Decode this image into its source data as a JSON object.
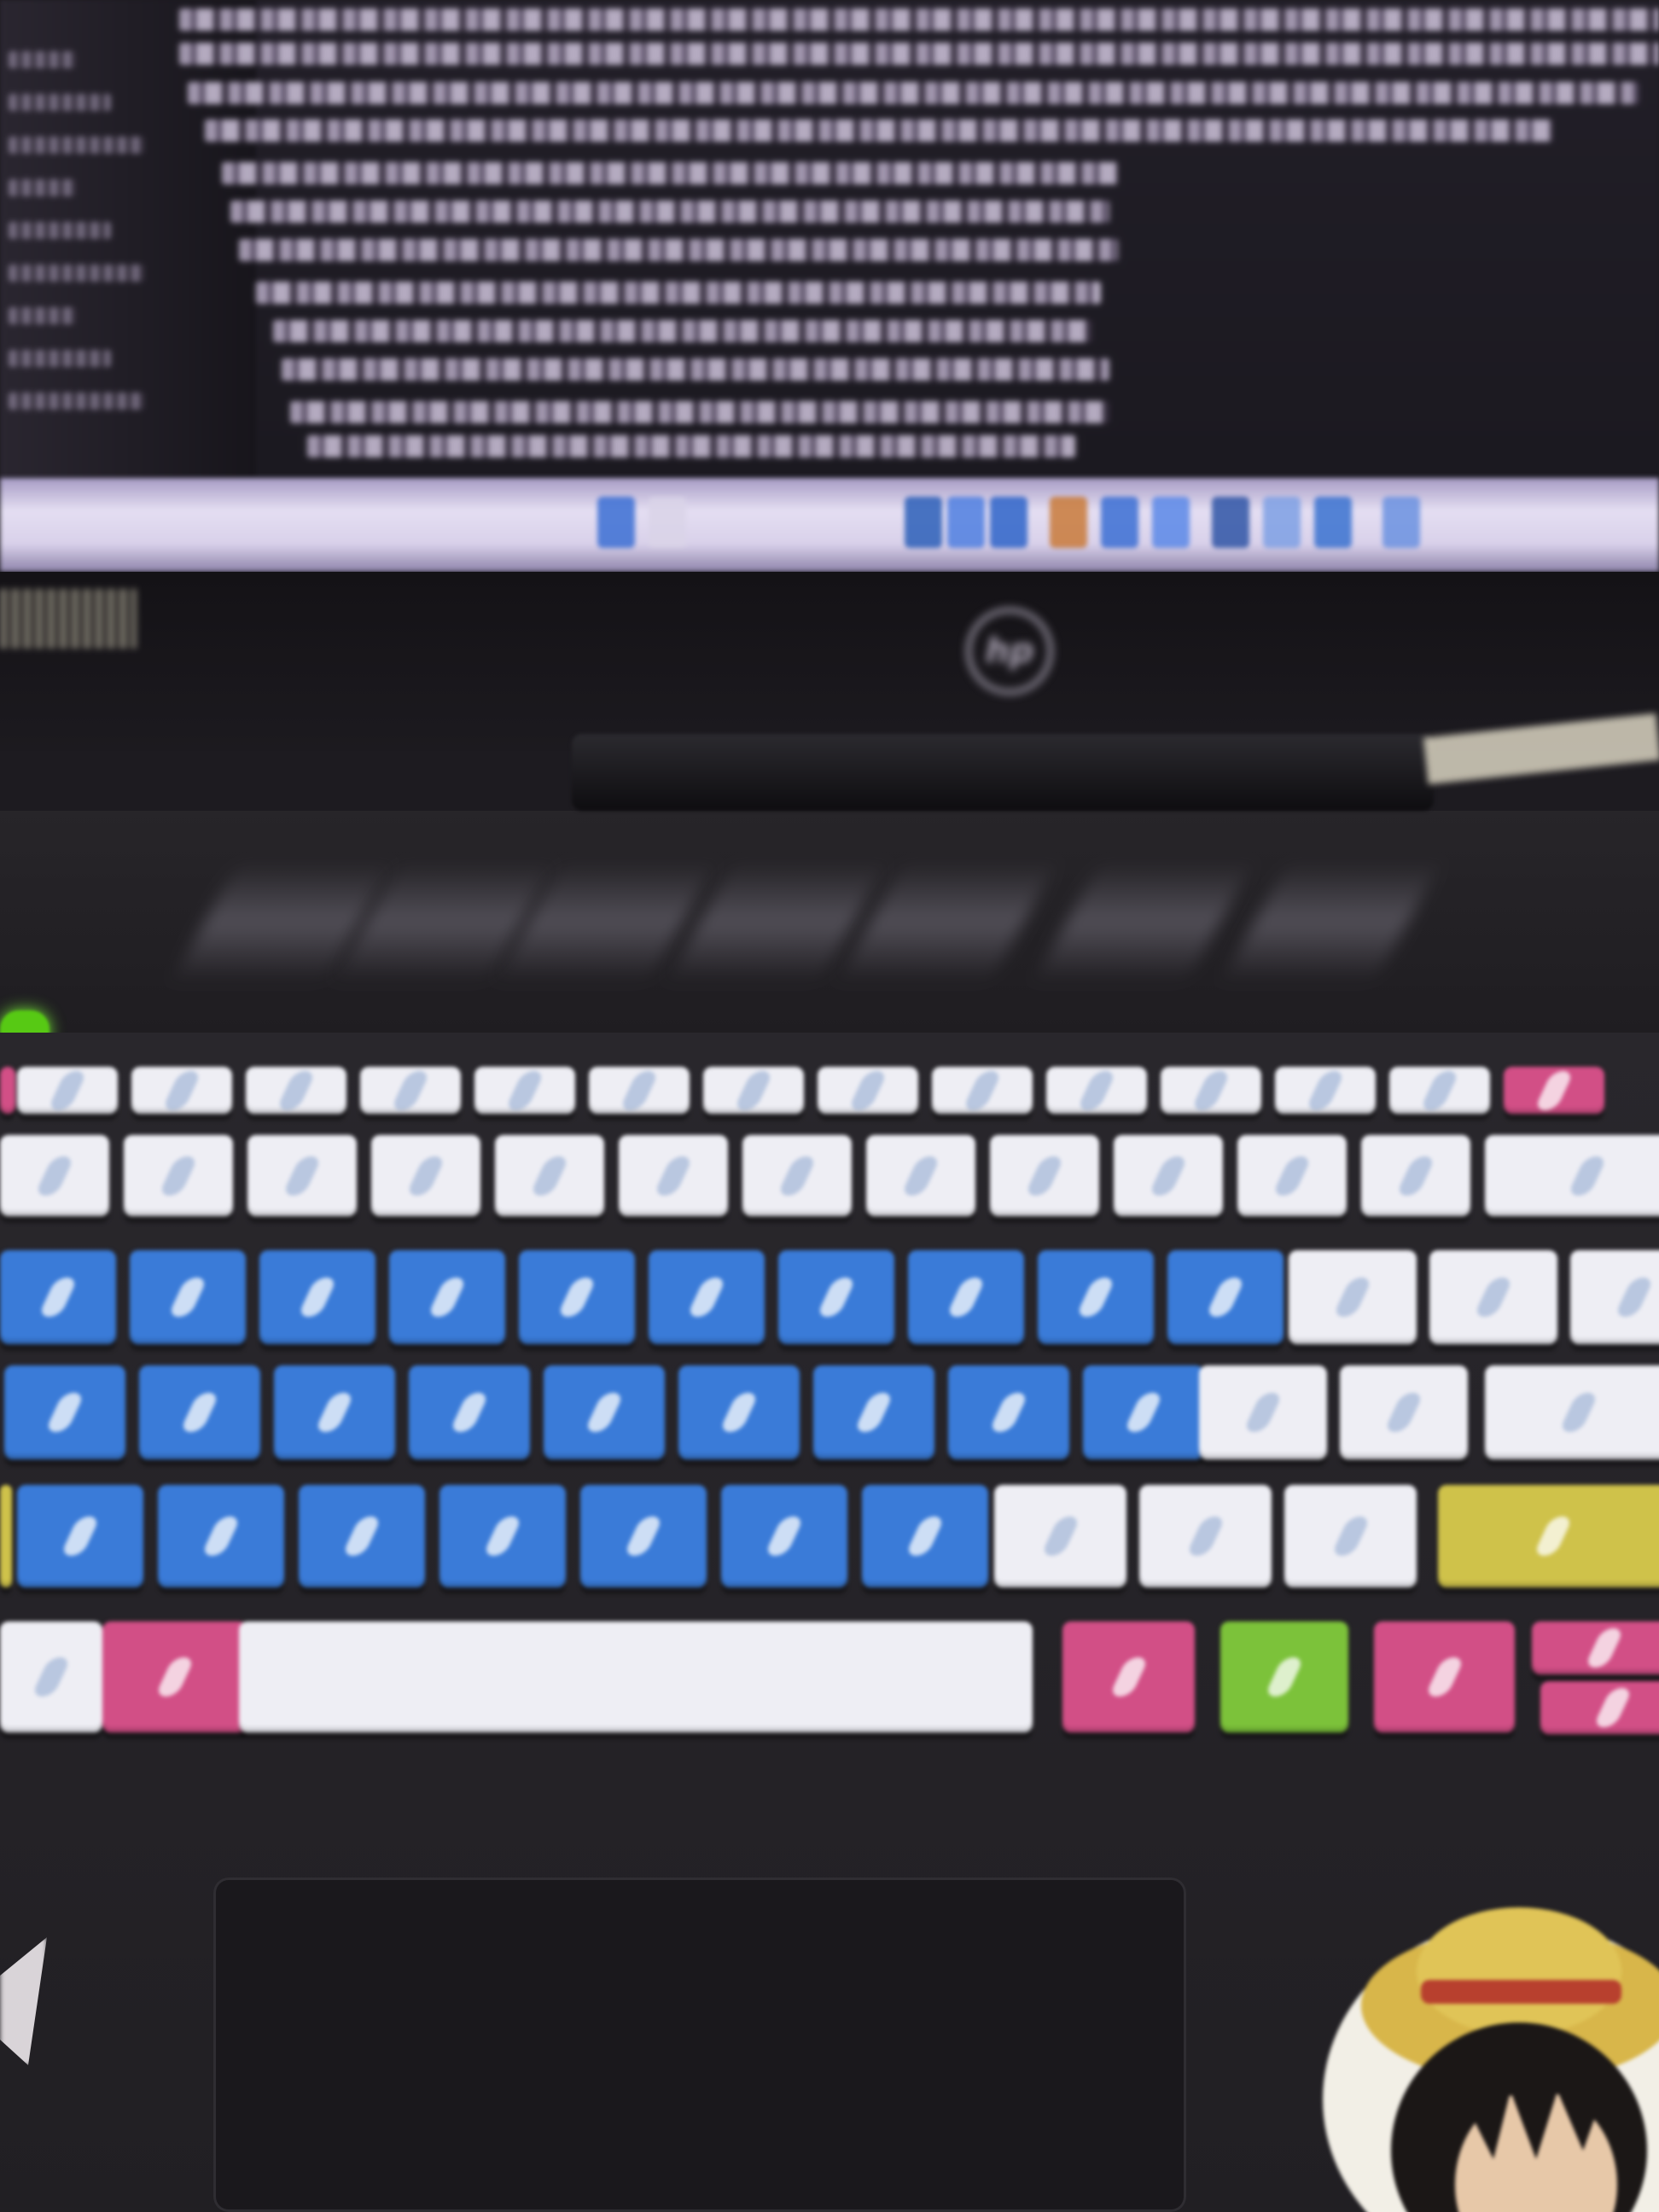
{
  "scene": {
    "description_type": "photo",
    "device_brand_logo": "hp",
    "keyboard_colors": {
      "white": "#eeeef4",
      "blue": "#3a7bd8",
      "pink": "#d24f86",
      "green": "#7cc23a",
      "yellow": "#cfc24a",
      "led": "#57c914"
    },
    "icons": [
      "hp-logo-icon",
      "power-led-icon",
      "windows-key-icon"
    ]
  }
}
